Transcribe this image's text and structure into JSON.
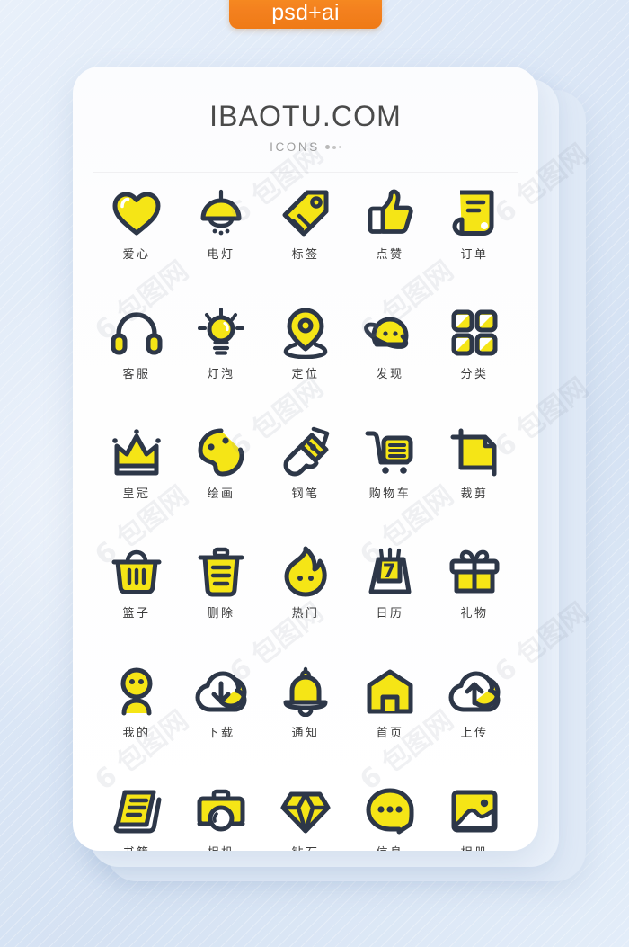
{
  "badge": {
    "label": "psd+ai",
    "color": "#f4811f"
  },
  "card": {
    "brand": "IBAOTU.COM",
    "subtitle": "ICONS"
  },
  "theme": {
    "stroke": "#2d3748",
    "fill": "#f5e516",
    "background": "#dde8f7",
    "card": "#ffffff",
    "label_color": "#3b3b3b"
  },
  "watermark": {
    "text": "6 包图网"
  },
  "icons": [
    {
      "name": "heart-icon",
      "label": "爱心"
    },
    {
      "name": "lamp-icon",
      "label": "电灯"
    },
    {
      "name": "tag-icon",
      "label": "标签"
    },
    {
      "name": "thumbs-up-icon",
      "label": "点赞"
    },
    {
      "name": "order-icon",
      "label": "订单"
    },
    {
      "name": "headphones-icon",
      "label": "客服"
    },
    {
      "name": "lightbulb-icon",
      "label": "灯泡"
    },
    {
      "name": "location-pin-icon",
      "label": "定位"
    },
    {
      "name": "planet-icon",
      "label": "发现"
    },
    {
      "name": "grid-icon",
      "label": "分类"
    },
    {
      "name": "crown-icon",
      "label": "皇冠"
    },
    {
      "name": "palette-icon",
      "label": "绘画"
    },
    {
      "name": "fountain-pen-icon",
      "label": "钢笔"
    },
    {
      "name": "shopping-cart-icon",
      "label": "购物车"
    },
    {
      "name": "crop-icon",
      "label": "裁剪"
    },
    {
      "name": "basket-icon",
      "label": "篮子"
    },
    {
      "name": "trash-icon",
      "label": "删除"
    },
    {
      "name": "flame-icon",
      "label": "热门"
    },
    {
      "name": "calendar-icon",
      "label": "日历",
      "badge_number": "7"
    },
    {
      "name": "gift-icon",
      "label": "礼物"
    },
    {
      "name": "user-icon",
      "label": "我的"
    },
    {
      "name": "cloud-download-icon",
      "label": "下载"
    },
    {
      "name": "bell-icon",
      "label": "通知"
    },
    {
      "name": "home-icon",
      "label": "首页"
    },
    {
      "name": "cloud-upload-icon",
      "label": "上传"
    },
    {
      "name": "book-icon",
      "label": "书籍"
    },
    {
      "name": "camera-icon",
      "label": "相机"
    },
    {
      "name": "diamond-icon",
      "label": "钻石"
    },
    {
      "name": "message-icon",
      "label": "信息"
    },
    {
      "name": "photo-album-icon",
      "label": "相册"
    }
  ]
}
